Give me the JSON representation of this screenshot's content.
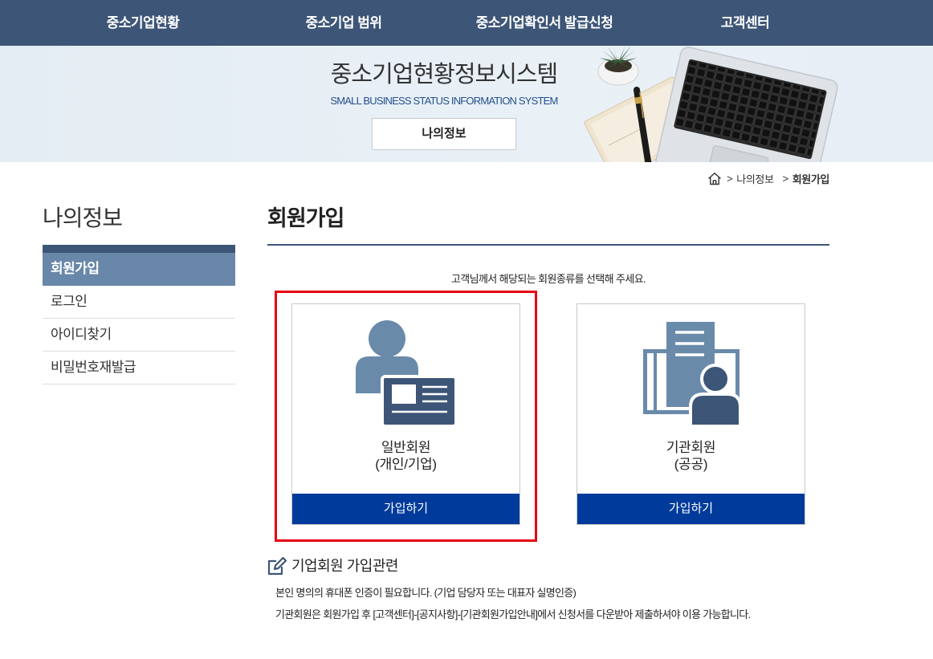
{
  "nav": {
    "items": [
      "중소기업현황",
      "중소기업 범위",
      "중소기업확인서 발급신청",
      "고객센터"
    ]
  },
  "banner": {
    "title": "중소기업현황정보시스템",
    "subtitle": "SMALL BUSINESS STATUS INFORMATION SYSTEM",
    "section_button": "나의정보",
    "illustration": "desk-with-laptop-notebook-pen-plant"
  },
  "breadcrumb": {
    "home_icon": "home-icon",
    "separator": ">",
    "items": [
      "나의정보",
      "회원가입"
    ]
  },
  "sidebar": {
    "title": "나의정보",
    "items": [
      {
        "label": "회원가입",
        "active": true
      },
      {
        "label": "로그인",
        "active": false
      },
      {
        "label": "아이디찾기",
        "active": false
      },
      {
        "label": "비밀번호재발급",
        "active": false
      }
    ]
  },
  "main": {
    "heading": "회원가입",
    "instruction": "고객님께서 해당되는 회원종류를 선택해 주세요.",
    "cards": [
      {
        "title": "일반회원",
        "subtitle": "(개인/기업)",
        "button": "가입하기",
        "icon": "person-id-card-icon",
        "highlighted": true
      },
      {
        "title": "기관회원",
        "subtitle": "(공공)",
        "button": "가입하기",
        "icon": "building-person-icon",
        "highlighted": false
      }
    ],
    "notice": {
      "icon": "edit-icon",
      "title": "기업회원 가입관련",
      "lines": [
        "본인 명의의 휴대폰 인증이 필요합니다. (기업 담당자 또는 대표자 실명인증)",
        "기관회원은 회원가입 후 [고객센터]-[공지사항]-[기관회원가입안내]에서 신청서를 다운받아 제출하셔야 이용 가능합니다."
      ]
    }
  },
  "colors": {
    "nav_bg": "#3d5577",
    "banner_bg": "#e7eef5",
    "banner_subtitle": "#24508f",
    "sidebar_active_bg": "#6887a9",
    "icon_steel_blue": "#6a8aaa",
    "icon_navy": "#3d5577",
    "join_button_bg": "#003b9b",
    "highlight": "#e60012"
  }
}
